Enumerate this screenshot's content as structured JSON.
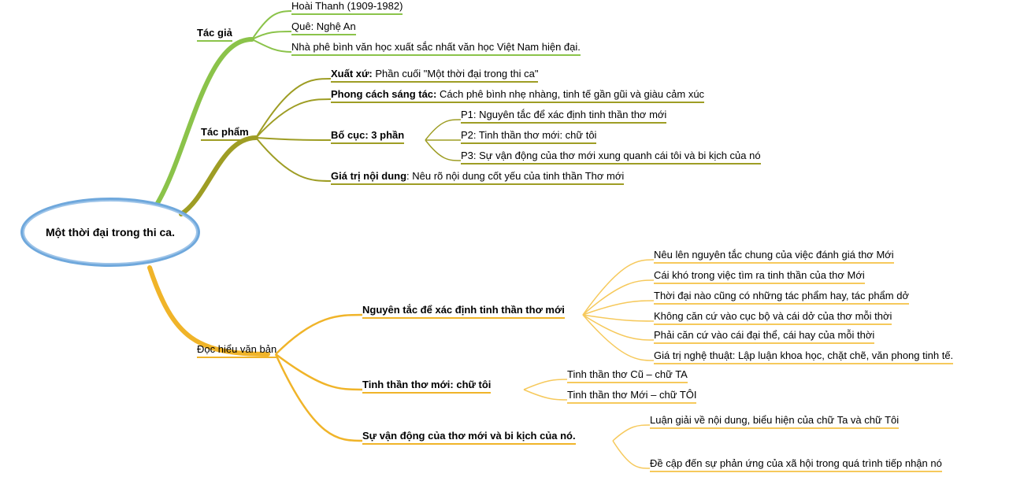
{
  "root": {
    "title": "Một thời đại trong thi ca."
  },
  "branches": {
    "tacgia": {
      "label": "Tác giả",
      "items": [
        "Hoài Thanh (1909-1982)",
        "Quê: Nghệ An",
        "Nhà phê bình văn học xuất sắc nhất văn học Việt Nam hiện đại."
      ]
    },
    "tacpham": {
      "label": "Tác phẩm",
      "xuatxu_bold": "Xuất xứ:",
      "xuatxu_text": " Phần cuối \"Một thời đại trong thi ca\"",
      "phongcach_bold": "Phong cách sáng tác:",
      "phongcach_text": " Cách phê bình nhẹ nhàng, tinh tế gần gũi và giàu cảm xúc",
      "bocuc_label": "Bố cục: 3 phần",
      "bocuc_items": [
        "P1: Nguyên tắc để xác định tinh thần thơ mới",
        "P2: Tinh thần thơ mới: chữ tôi",
        "P3: Sự vận động của thơ mới xung quanh cái tôi và bi kịch của nó"
      ],
      "giatri_bold": "Giá trị nội dung",
      "giatri_text": ": Nêu rõ nội dung cốt yếu của tinh thần Thơ mới"
    },
    "dochieu": {
      "label": "Đọc hiểu văn bản",
      "nguyentac": {
        "label": "Nguyên tắc để xác định tinh thần thơ mới",
        "items": [
          "Nêu lên nguyên tắc chung của việc đánh giá thơ Mới",
          "Cái khó trong việc tìm ra tinh thần của thơ Mới",
          "Thời đại nào cũng có những tác phẩm hay, tác phẩm dở",
          "Không căn cứ vào cục bộ và cái dở của thơ mỗi thời",
          "Phải căn cứ vào cái đại thể, cái hay của mỗi thời",
          "Giá trị nghệ thuật: Lập luận khoa học, chặt chẽ, văn phong tinh tế."
        ]
      },
      "tinhthan": {
        "label": "Tinh thần thơ mới: chữ tôi",
        "items": [
          "Tinh thần thơ Cũ – chữ TA",
          "Tinh thần thơ Mới – chữ TÔI"
        ]
      },
      "suvandong": {
        "label": "Sự vận động của thơ mới và bi kịch của nó.",
        "items": [
          "Luận giải về nội dung, biểu hiện của chữ Ta và chữ Tôi",
          "Đề cập đến sự phản ứng của xã hội trong quá trình tiếp nhận nó"
        ]
      }
    }
  },
  "colors": {
    "root_stroke": "#6fa8dc",
    "green_light": "#8bc34a",
    "green_olive": "#9e9d24",
    "yellow": "#f0b429",
    "yellow_light": "#f6c95c"
  }
}
